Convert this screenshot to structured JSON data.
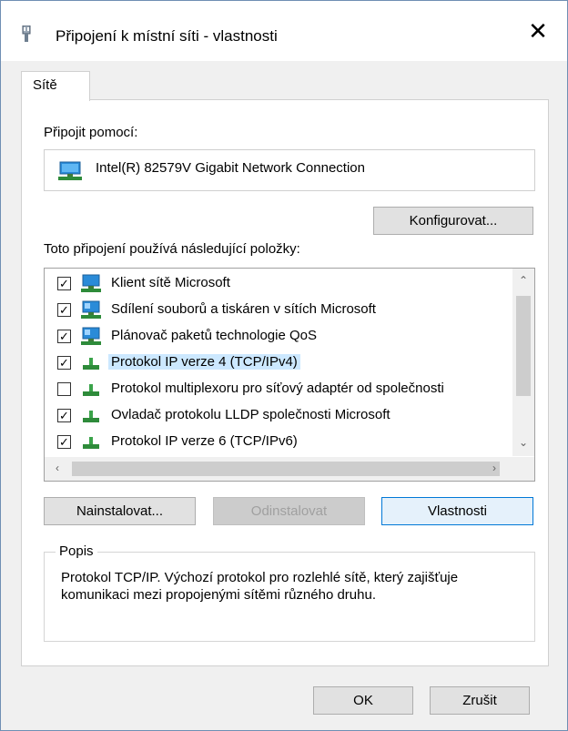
{
  "window": {
    "title": "Připojení k místní síti - vlastnosti",
    "close_glyph": "✕"
  },
  "tabs": [
    {
      "label": "Sítě",
      "active": true
    }
  ],
  "connect_using": {
    "label": "Připojit pomocí:",
    "adapter": "Intel(R) 82579V Gigabit Network Connection",
    "configure_button": "Konfigurovat..."
  },
  "items_section": {
    "label": "Toto připojení používá následující položky:",
    "items": [
      {
        "label": "Klient sítě Microsoft",
        "checked": true,
        "icon": "network-client-icon",
        "selected": false
      },
      {
        "label": "Sdílení souborů a tiskáren v sítích Microsoft",
        "checked": true,
        "icon": "network-service-icon",
        "selected": false
      },
      {
        "label": "Plánovač paketů technologie QoS",
        "checked": true,
        "icon": "network-service-icon",
        "selected": false
      },
      {
        "label": "Protokol IP verze 4 (TCP/IPv4)",
        "checked": true,
        "icon": "protocol-icon",
        "selected": true
      },
      {
        "label": "Protokol multiplexoru pro síťový adaptér od společnosti",
        "checked": false,
        "icon": "protocol-icon",
        "selected": false
      },
      {
        "label": "Ovladač protokolu LLDP společnosti Microsoft",
        "checked": true,
        "icon": "protocol-icon",
        "selected": false
      },
      {
        "label": "Protokol IP verze 6 (TCP/IPv6)",
        "checked": true,
        "icon": "protocol-icon",
        "selected": false
      }
    ]
  },
  "actions": {
    "install": "Nainstalovat...",
    "uninstall": "Odinstalovat",
    "properties": "Vlastnosti"
  },
  "description": {
    "title": "Popis",
    "text": "Protokol TCP/IP. Výchozí protokol pro rozlehlé sítě, který zajišťuje komunikaci mezi propojenými sítěmi různého druhu."
  },
  "footer": {
    "ok": "OK",
    "cancel": "Zrušit"
  }
}
